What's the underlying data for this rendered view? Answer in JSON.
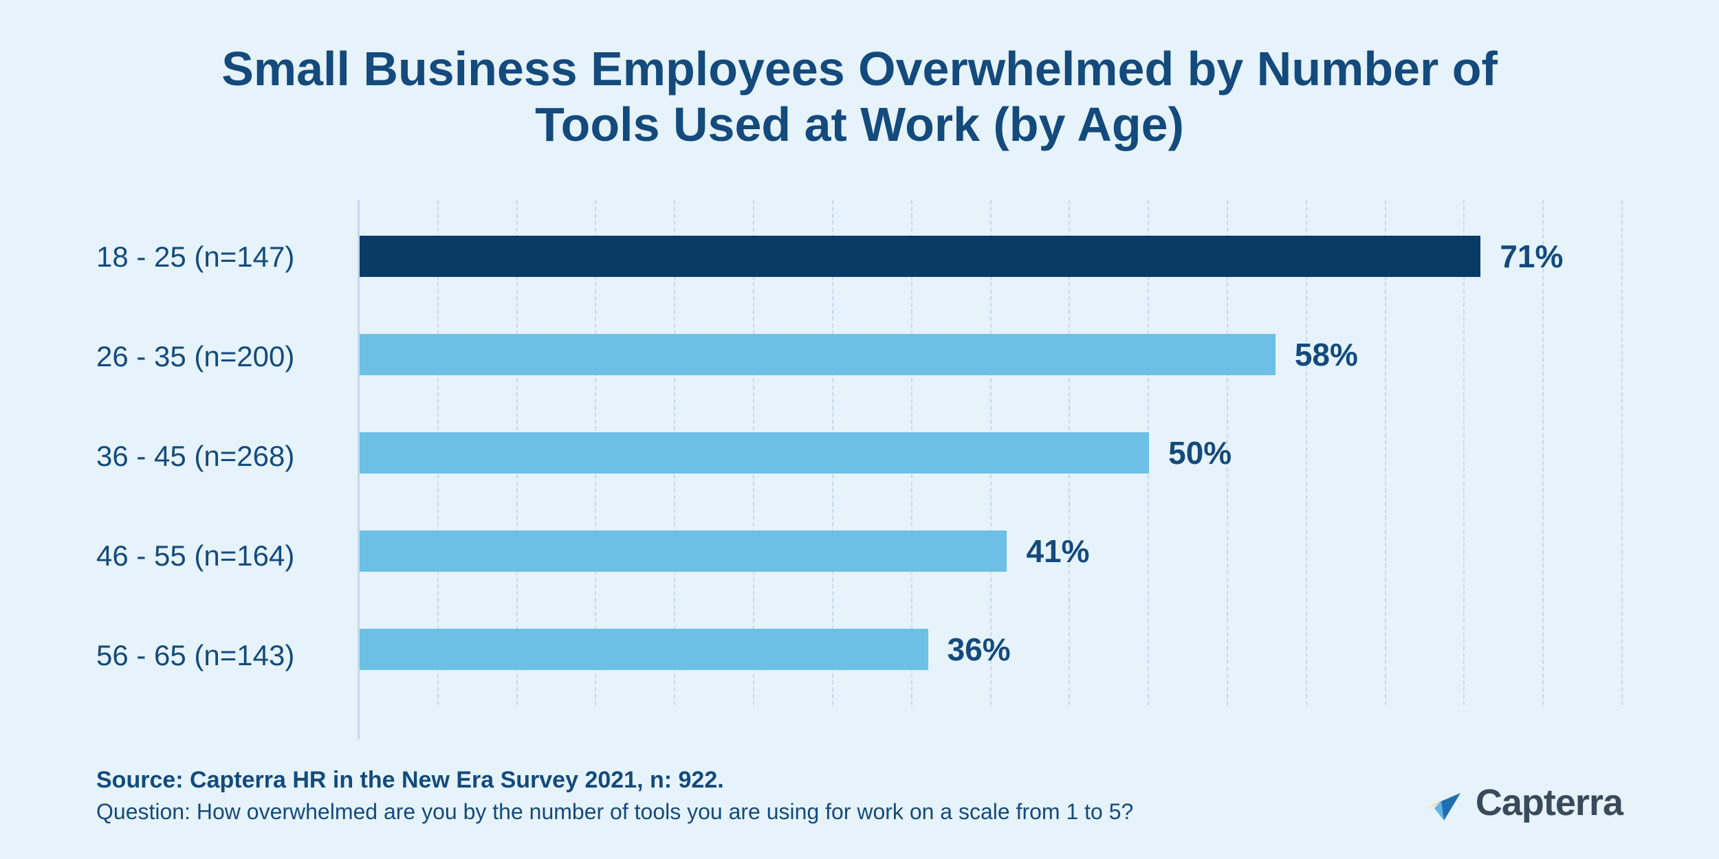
{
  "chart_data": {
    "type": "bar",
    "orientation": "horizontal",
    "title": "Small Business Employees Overwhelmed by Number of Tools Used at Work (by Age)",
    "categories": [
      "18 - 25 (n=147)",
      "26 - 35 (n=200)",
      "36 - 45 (n=268)",
      "46 - 55 (n=164)",
      "56 - 65 (n=143)"
    ],
    "values": [
      71,
      58,
      50,
      41,
      36
    ],
    "value_suffix": "%",
    "highlight_index": 0,
    "xlim": [
      0,
      80
    ],
    "grid_step": 5,
    "xlabel": "",
    "ylabel": ""
  },
  "colors": {
    "background": "#e6f3fa",
    "text": "#144a7c",
    "bar": "#6cc0e5",
    "bar_highlight": "#0b3a66",
    "grid": "#c7d9e8"
  },
  "footer": {
    "source": "Source: Capterra HR in the New Era Survey 2021, n: 922.",
    "question": "Question: How overwhelmed are you by the number of tools you are using for work on a scale from 1 to 5?"
  },
  "brand": {
    "name": "Capterra"
  }
}
